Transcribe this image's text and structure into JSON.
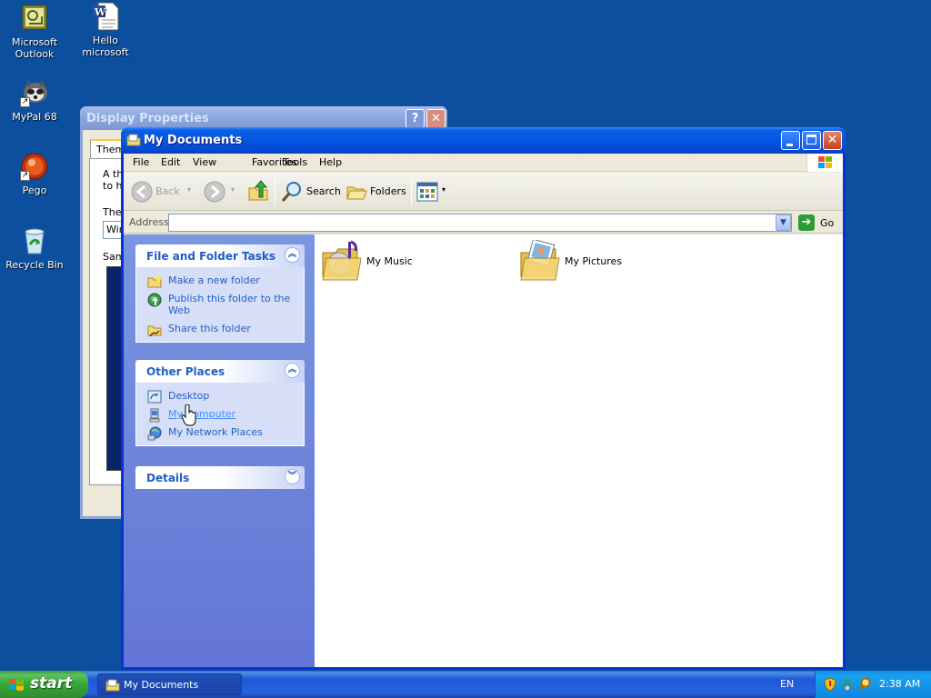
{
  "desktop": {
    "icons": [
      {
        "label_line1": "Microsoft",
        "label_line2": "Outlook",
        "icon": "outlook-icon"
      },
      {
        "label_line1": "Hello microsoft",
        "icon": "word-document-icon"
      },
      {
        "label_line1": "MyPal 68",
        "icon": "mypal-icon"
      },
      {
        "label_line1": "Pego",
        "icon": "pego-icon"
      },
      {
        "label_line1": "Recycle Bin",
        "icon": "recycle-bin-icon"
      }
    ]
  },
  "display_properties": {
    "title": "Display Properties",
    "tab": "Them",
    "text1_line1": "A th",
    "text1_line2": "to he",
    "text2": "The",
    "combo": "Win",
    "text3": "Sam"
  },
  "window": {
    "title": "My Documents",
    "menu": [
      "File",
      "Edit",
      "View",
      "Favorites",
      "Tools",
      "Help"
    ],
    "toolbar": {
      "back": "Back",
      "search": "Search",
      "folders": "Folders"
    },
    "address": {
      "label": "Address",
      "value": "",
      "go": "Go"
    }
  },
  "taskpane": {
    "file_folder_tasks": {
      "title": "File and Folder Tasks",
      "links": [
        "Make a new folder",
        "Publish this folder to the Web",
        "Share this folder"
      ]
    },
    "other_places": {
      "title": "Other Places",
      "links": [
        "Desktop",
        "My Computer",
        "My Network Places"
      ]
    },
    "details": {
      "title": "Details"
    }
  },
  "content": {
    "items": [
      {
        "label": "My Music",
        "icon": "music-folder-icon"
      },
      {
        "label": "My Pictures",
        "icon": "pictures-folder-icon"
      }
    ]
  },
  "taskbar": {
    "start": "start",
    "task_button": "My Documents",
    "language": "EN",
    "clock": "2:38 AM"
  }
}
